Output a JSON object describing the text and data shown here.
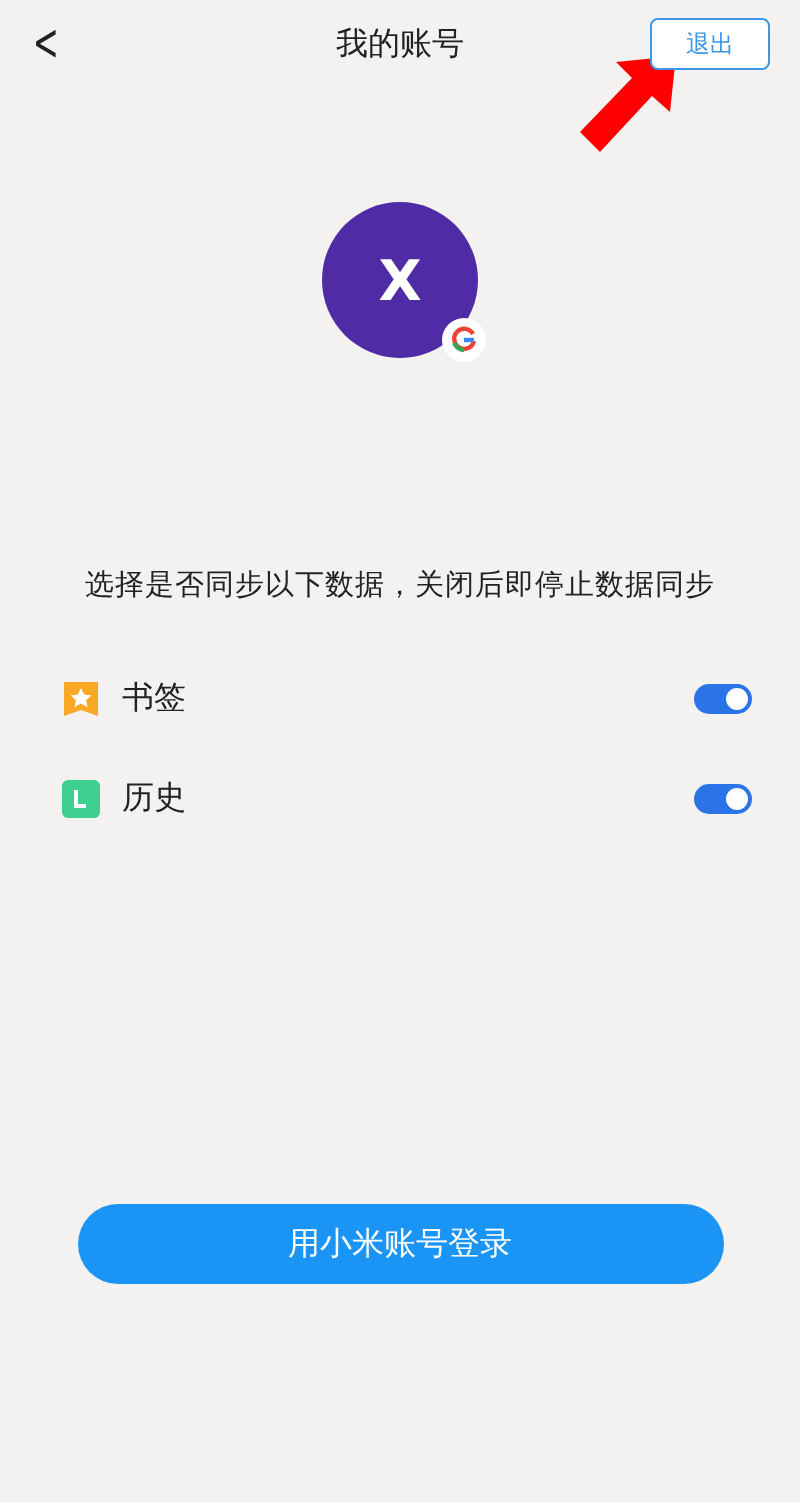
{
  "header": {
    "back_icon": "<",
    "title": "我的账号",
    "logout_button": "退出"
  },
  "avatar": {
    "initial": "X"
  },
  "sync_hint": "选择是否同步以下数据，关闭后即停止数据同步",
  "sync_items": [
    {
      "kind": "bookmark",
      "label": "书签",
      "on": true
    },
    {
      "kind": "history",
      "label": "历史",
      "on": true
    }
  ],
  "login_button": "用小米账号登录"
}
